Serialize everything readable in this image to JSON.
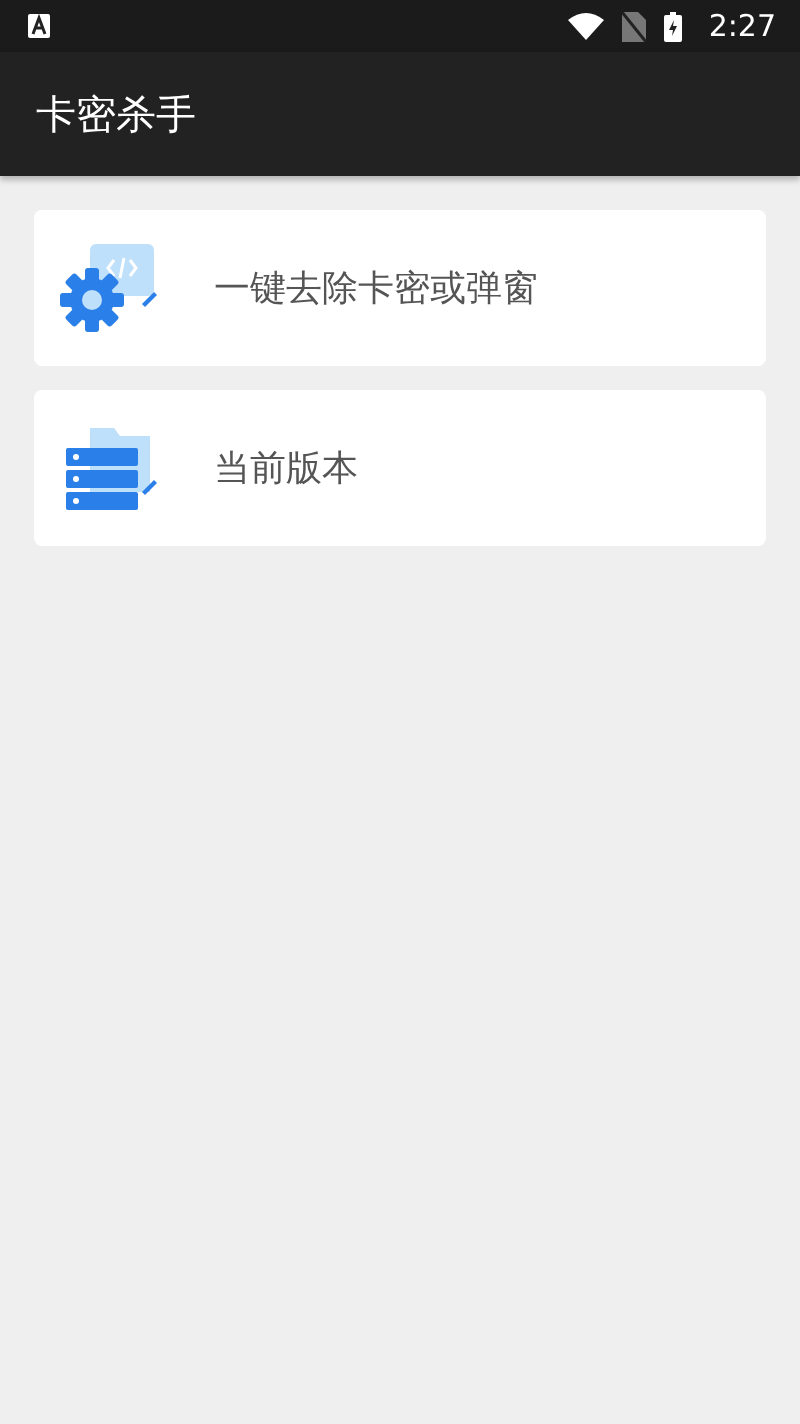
{
  "status_bar": {
    "time": "2:27"
  },
  "app_bar": {
    "title": "卡密杀手"
  },
  "items": [
    {
      "kind": "gear",
      "label": "一键去除卡密或弹窗"
    },
    {
      "kind": "server",
      "label": "当前版本"
    }
  ]
}
